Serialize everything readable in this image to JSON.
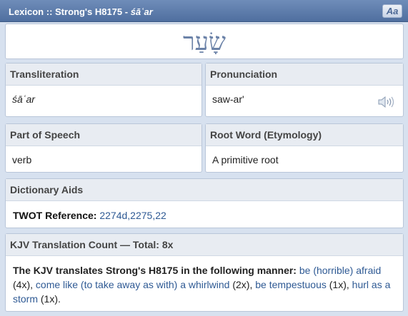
{
  "window": {
    "title_prefix": "Lexicon :: Strong's H8175 - ",
    "title_word": "śāʿar",
    "font_toggle": "Aa"
  },
  "hebrew": "שָׂעַר",
  "transliteration": {
    "label": "Transliteration",
    "value": "śāʿar"
  },
  "pronunciation": {
    "label": "Pronunciation",
    "value": "saw-ar'",
    "audio_icon": "speaker-icon"
  },
  "part_of_speech": {
    "label": "Part of Speech",
    "value": "verb"
  },
  "root_word": {
    "label": "Root Word (Etymology)",
    "value": "A primitive root"
  },
  "dictionary_aids": {
    "label": "Dictionary Aids",
    "twot_label": "TWOT Reference:",
    "twot_value": "2274d,2275,22"
  },
  "kjv": {
    "label": "KJV Translation Count — Total: 8x",
    "intro": "The KJV translates Strong's H8175 in the following manner:",
    "items": [
      {
        "text": "be (horrible) afraid",
        "count": "(4x)",
        "sep": ", "
      },
      {
        "text": "come like (to take away as with) a whirlwind",
        "count": "(2x)",
        "sep": ", "
      },
      {
        "text": "be tempestuous",
        "count": "(1x)",
        "sep": ", "
      },
      {
        "text": "hurl as a storm",
        "count": "(1x)",
        "sep": "."
      }
    ]
  },
  "colors": {
    "titlebar": "#5a78a8",
    "accent": "#2f5a94",
    "hebrew": "#6b82a8"
  }
}
